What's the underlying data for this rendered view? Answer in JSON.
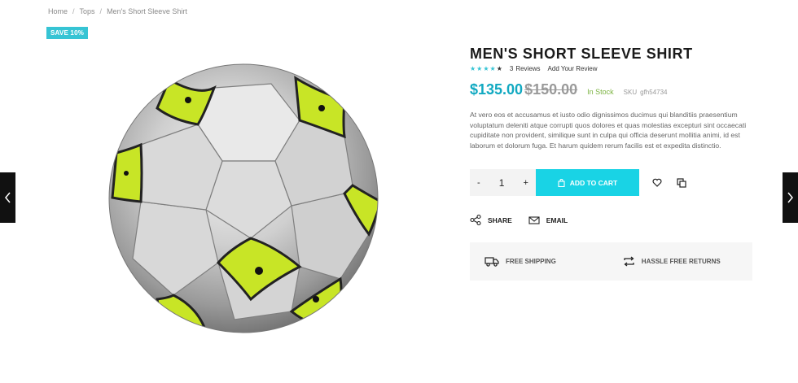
{
  "breadcrumb": {
    "home": "Home",
    "category": "Tops",
    "current": "Men's Short Sleeve Shirt",
    "separator": "/"
  },
  "badge": "SAVE 10%",
  "product": {
    "title": "MEN'S SHORT SLEEVE SHIRT",
    "rating": 4,
    "rating_max": 5,
    "reviews_count": "3",
    "reviews_label": "Reviews",
    "add_review": "Add Your Review",
    "price": "$135.00",
    "old_price": "$150.00",
    "stock": "In Stock",
    "sku_label": "SKU",
    "sku": "gfh54734",
    "description": "At vero eos et accusamus et iusto odio dignissimos ducimus qui blanditiis praesentium voluptatum deleniti atque corrupti quos dolores et quas molestias excepturi sint occaecati cupiditate non provident, similique sunt in culpa qui officia deserunt mollitia animi, id est laborum et dolorum fuga. Et harum quidem rerum facilis est et expedita distinctio."
  },
  "cart": {
    "minus": "-",
    "quantity": "1",
    "plus": "+",
    "add_label": "ADD TO CART"
  },
  "share": {
    "share_label": "SHARE",
    "email_label": "EMAIL"
  },
  "features": {
    "shipping": "FREE SHIPPING",
    "returns": "HASSLE FREE RETURNS"
  },
  "icons": {
    "prev": "chevron-left-icon",
    "next": "chevron-right-icon",
    "wishlist": "heart-icon",
    "compare": "compare-icon",
    "cart": "shopping-bag-icon",
    "share": "share-icon",
    "email": "envelope-icon",
    "shipping": "truck-icon",
    "returns": "return-icon"
  },
  "colors": {
    "accent": "#19d3e5",
    "price": "#11a9c1",
    "badge": "#36c4d4",
    "stock": "#7cb342",
    "ball_yellow": "#c8e526"
  }
}
